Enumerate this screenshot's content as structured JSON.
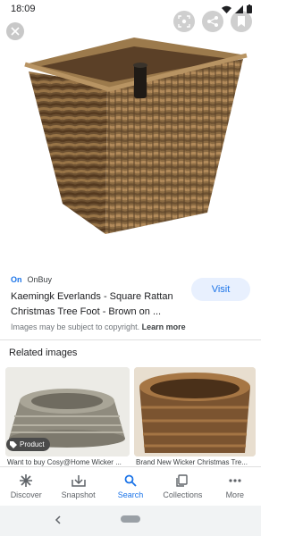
{
  "status_bar": {
    "time": "18:09"
  },
  "result": {
    "source_name": "OnBuy",
    "source_logo_text": "On",
    "title": "Kaemingk Everlands - Square Rattan Christmas Tree Foot - Brown on ...",
    "visit_label": "Visit",
    "copyright_text": "Images may be subject to copyright.",
    "learn_more_label": "Learn more"
  },
  "related": {
    "heading": "Related images",
    "items": [
      {
        "caption": "Want to buy Cosy@Home Wicker ...",
        "badge": "Product"
      },
      {
        "caption": "Brand New Wicker Christmas Tre..."
      }
    ]
  },
  "bottom_nav": {
    "items": [
      {
        "label": "Discover",
        "icon": "asterisk-icon"
      },
      {
        "label": "Snapshot",
        "icon": "snapshot-tray-icon"
      },
      {
        "label": "Search",
        "icon": "search-icon",
        "active": true
      },
      {
        "label": "Collections",
        "icon": "collections-icon"
      },
      {
        "label": "More",
        "icon": "more-dots-icon"
      }
    ]
  },
  "colors": {
    "accent": "#1a73e8",
    "visit_bg": "#e8f0fe",
    "text": "#202124",
    "muted": "#70757a"
  }
}
